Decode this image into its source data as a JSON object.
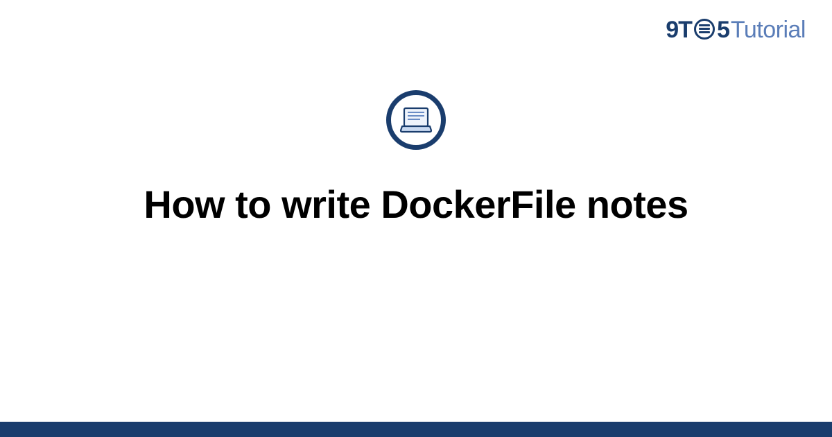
{
  "logo": {
    "part1": "9T",
    "part2": "5",
    "part3": "Tutorial"
  },
  "main": {
    "title": "How to write DockerFile notes"
  },
  "colors": {
    "brand_dark": "#1a3d6d",
    "brand_light": "#5a7db8",
    "icon_stroke": "#1a3d6d",
    "icon_fill_light": "#c9d9f0"
  }
}
